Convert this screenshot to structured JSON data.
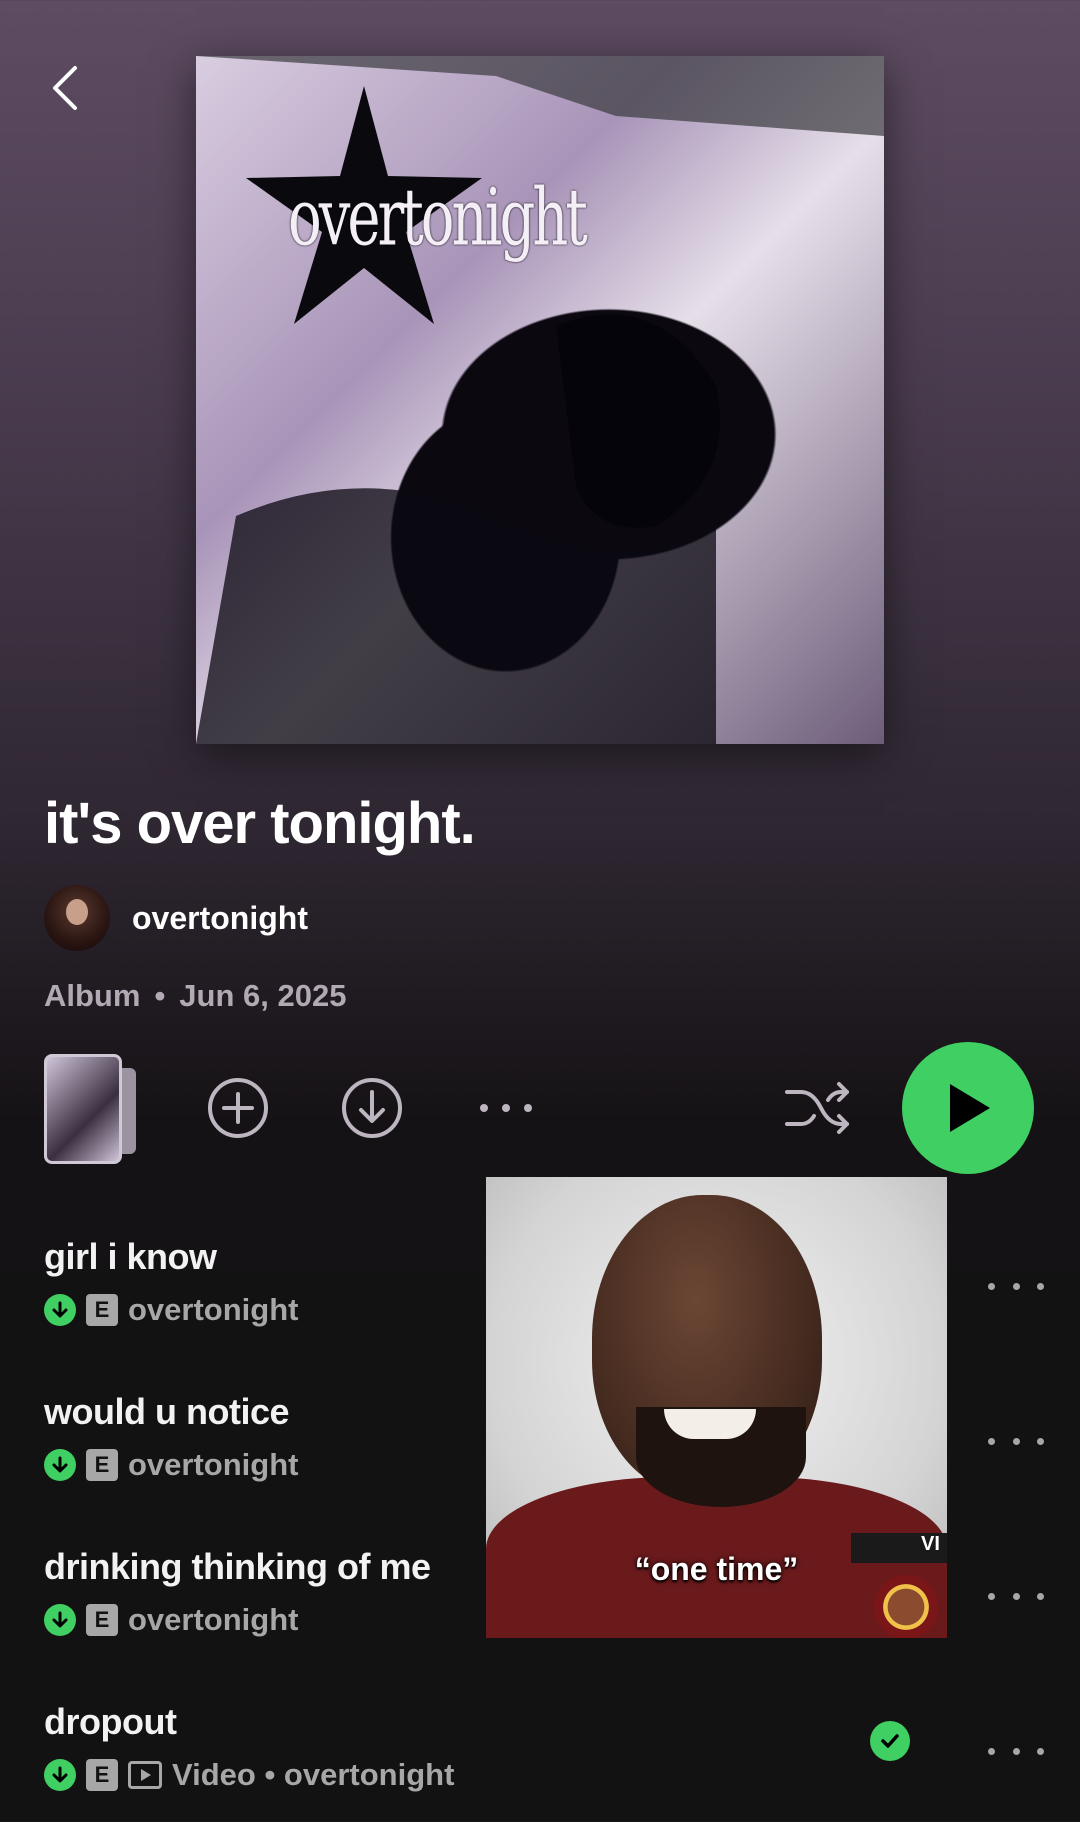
{
  "album": {
    "cover_text": "overtonight",
    "title": "it's over tonight.",
    "artist": "overtonight",
    "type": "Album",
    "separator": "•",
    "date": "Jun 6, 2025"
  },
  "controls": {
    "add_icon": "plus-circle-icon",
    "download_icon": "download-circle-icon",
    "more_icon": "more-horizontal-icon",
    "shuffle_icon": "shuffle-icon",
    "play_icon": "play-icon",
    "accent_color": "#3fcf62"
  },
  "tracks": [
    {
      "title": "girl i know",
      "explicit": "E",
      "subtitle": "overtonight"
    },
    {
      "title": "would u notice",
      "explicit": "E",
      "subtitle": "overtonight"
    },
    {
      "title": "drinking thinking of me",
      "explicit": "E",
      "subtitle": "overtonight"
    },
    {
      "title": "dropout",
      "explicit": "E",
      "subtitle": "Video • overtonight"
    }
  ],
  "overlay": {
    "caption": "“one time”",
    "tag": "VI"
  }
}
